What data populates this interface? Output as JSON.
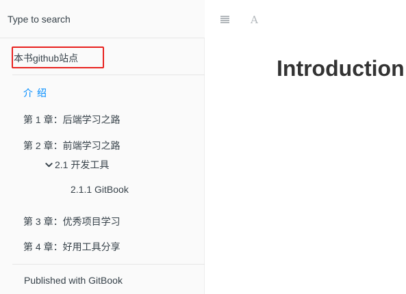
{
  "search": {
    "placeholder": "Type to search"
  },
  "sidebar": {
    "github_link": "本书github站点",
    "items": [
      {
        "label": "介绍",
        "active": true
      },
      {
        "label": "第 1 章：后端学习之路"
      },
      {
        "label": "第 2 章：前端学习之路"
      },
      {
        "label": "2.1 开发工具",
        "expanded": true,
        "icon": "chevron-down-icon"
      },
      {
        "label": "2.1.1 GitBook"
      },
      {
        "label": "第 3 章：优秀项目学习"
      },
      {
        "label": "第 4 章：好用工具分享"
      }
    ],
    "footer": "Published with GitBook"
  },
  "toolbar": {
    "menu_icon": "hamburger-menu-icon",
    "font_icon": "A"
  },
  "main": {
    "title": "Introduction"
  },
  "colors": {
    "active": "#008cff",
    "highlight_border": "#e8201d",
    "sidebar_bg": "#fafafa",
    "text": "#364149"
  }
}
